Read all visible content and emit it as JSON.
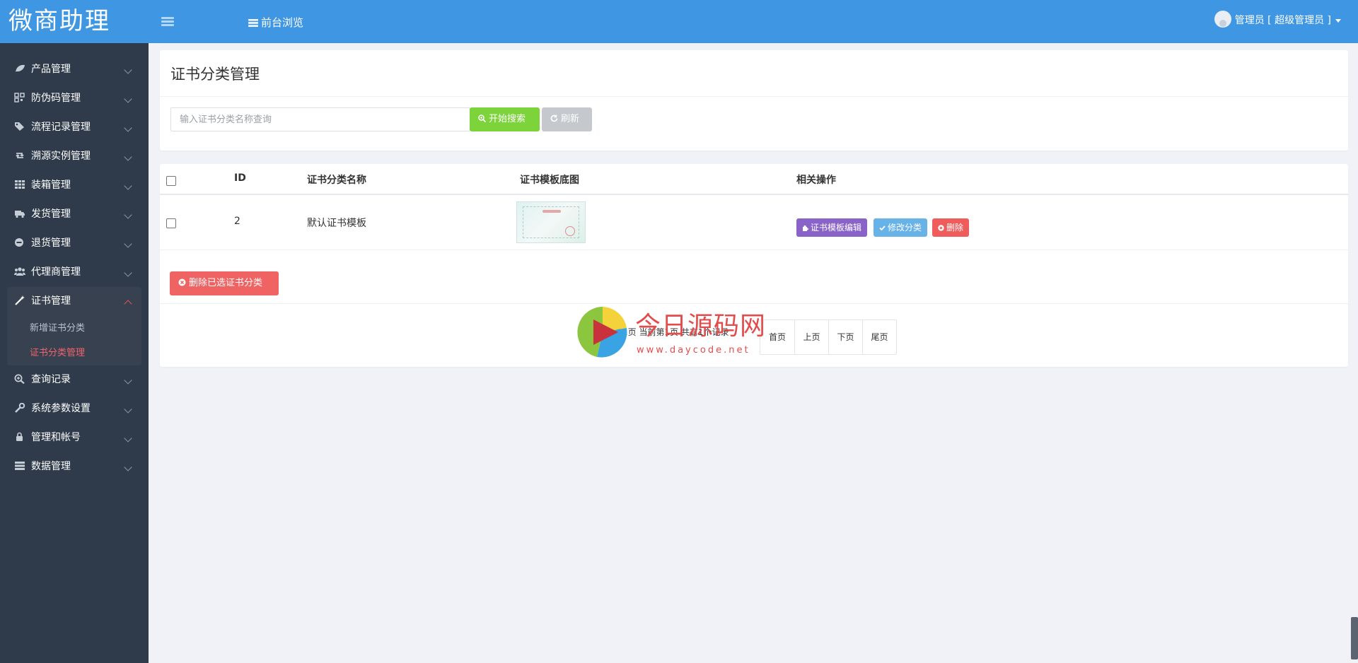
{
  "app": {
    "brand": "微商助理"
  },
  "topbar": {
    "front_link": "前台浏览",
    "user_label": "管理员 [ 超级管理员 ]"
  },
  "sidebar": {
    "items": [
      {
        "label": "产品管理",
        "icon": "leaf-icon"
      },
      {
        "label": "防伪码管理",
        "icon": "qrcode-icon"
      },
      {
        "label": "流程记录管理",
        "icon": "tags-icon"
      },
      {
        "label": "溯源实例管理",
        "icon": "retweet-icon"
      },
      {
        "label": "装箱管理",
        "icon": "grid-icon"
      },
      {
        "label": "发货管理",
        "icon": "truck-icon"
      },
      {
        "label": "退货管理",
        "icon": "minus-circle-icon"
      },
      {
        "label": "代理商管理",
        "icon": "users-icon"
      },
      {
        "label": "证书管理",
        "icon": "magic-wand-icon"
      },
      {
        "label": "查询记录",
        "icon": "search-plus-icon"
      },
      {
        "label": "系统参数设置",
        "icon": "wrench-icon"
      },
      {
        "label": "管理和帐号",
        "icon": "lock-icon"
      },
      {
        "label": "数据管理",
        "icon": "server-icon"
      }
    ],
    "sub_items": [
      {
        "label": "新增证书分类"
      },
      {
        "label": "证书分类管理"
      }
    ]
  },
  "page": {
    "title": "证书分类管理",
    "search_placeholder": "输入证书分类名称查询",
    "search_button": "开始搜索",
    "refresh_button": "刷新"
  },
  "table": {
    "headers": {
      "id": "ID",
      "name": "证书分类名称",
      "image": "证书模板底图",
      "actions": "相关操作"
    },
    "rows": [
      {
        "id": "2",
        "name": "默认证书模板"
      }
    ],
    "row_actions": {
      "edit_template": "证书模板编辑",
      "edit_category": "修改分类",
      "delete": "删除"
    },
    "bulk_delete": "删除已选证书分类"
  },
  "pagination": {
    "info": "共有1页 当前第1页 共有1个记录",
    "first": "首页",
    "prev": "上页",
    "next": "下页",
    "last": "尾页"
  },
  "watermark": {
    "title": "今日源码网",
    "url": "www.daycode.net"
  },
  "colors": {
    "topbar": "#3f97e3",
    "sidebar": "#2f3a4a",
    "active_sub": "#f0646c",
    "search_btn": "#7cd33a",
    "danger": "#ef5c5c",
    "purple": "#8a63c9",
    "info": "#67b3e8"
  }
}
